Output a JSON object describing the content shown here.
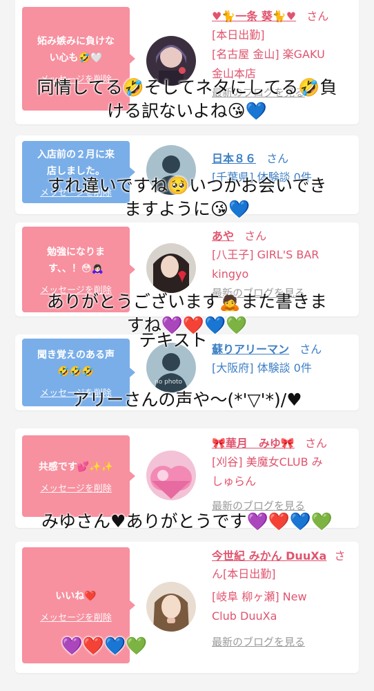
{
  "cards": [
    {
      "bubble": {
        "text": "妬み嫉みに負けな\nい心も🤣🤍",
        "delete": "メッセージを削除",
        "color": "pink"
      },
      "name": "♥🐈一条 葵🐈♥",
      "suffix": "さん",
      "lines": [
        "[本日出勤]",
        "[名古屋 金山] 楽GAKU",
        "金山本店"
      ],
      "blog": "最新のブログを見る",
      "avatar": "avatar-photo"
    },
    {
      "bubble": {
        "text": "入店前の２月に来\n店しました。",
        "delete": "メッセージを削除",
        "color": "blue"
      },
      "name": "日本８６",
      "suffix": "さん",
      "lines": [
        "[千葉県] 体験談 0件"
      ],
      "blog": "",
      "avatar": "no-photo"
    },
    {
      "bubble": {
        "text": "勉強になりま\nす、、！😳🙇🏻‍♀️",
        "delete": "メッセージを削除",
        "color": "pink"
      },
      "name": "あや",
      "suffix": "さん",
      "lines": [
        "[八王子] GIRL'S BAR",
        "kingyo"
      ],
      "blog": "最新のブログを見る",
      "avatar": "avatar-photo"
    },
    {
      "bubble": {
        "text": "聞き覚えのある声\n🤣🤣🤣",
        "delete": "メッセージを削除",
        "color": "blue"
      },
      "name": "蘇りアリーマン",
      "suffix": "さん",
      "lines": [
        "[大阪府] 体験談 0件"
      ],
      "blog": "",
      "avatar": "no-photo",
      "avatar_caption": "no photo"
    },
    {
      "bubble": {
        "text": "共感です💕✨✨",
        "delete": "メッセージを削除",
        "color": "pink"
      },
      "name": "🎀華月　みゆ🎀",
      "suffix": "さん",
      "lines": [
        "[刈谷] 美魔女CLUB み",
        "しゅらん"
      ],
      "blog": "最新のブログを見る",
      "avatar": "avatar-photo"
    },
    {
      "bubble": {
        "text": "いいね❤️",
        "delete": "メッセージを削除",
        "color": "pink"
      },
      "name": "今世紀 みかん DuuXa",
      "suffix": "さん[本日出勤]",
      "lines": [
        "[岐阜 柳ヶ瀬] New",
        "Club DuuXa"
      ],
      "blog": "最新のブログを見る",
      "avatar": "avatar-photo"
    }
  ],
  "overlays": [
    "同情してる🤣そしてネタにしてる🤣負\nける訳ないよね😘💙",
    "すれ違いですね🥺いつかお会いでき\nますように😘💙",
    "ありがとうございます🙇また書きま\nすね💜❤️💙💚",
    "テキスト",
    "アリーさんの声や～(*'▽'*)/♥",
    "みゆさん♥ありがとうです💜❤️💙💚",
    "💜❤️💙💚"
  ],
  "colors": {
    "pink": "#f7909f",
    "blue": "#7aaee8",
    "link_pink": "#e0546e",
    "link_blue": "#3d7fc4"
  }
}
